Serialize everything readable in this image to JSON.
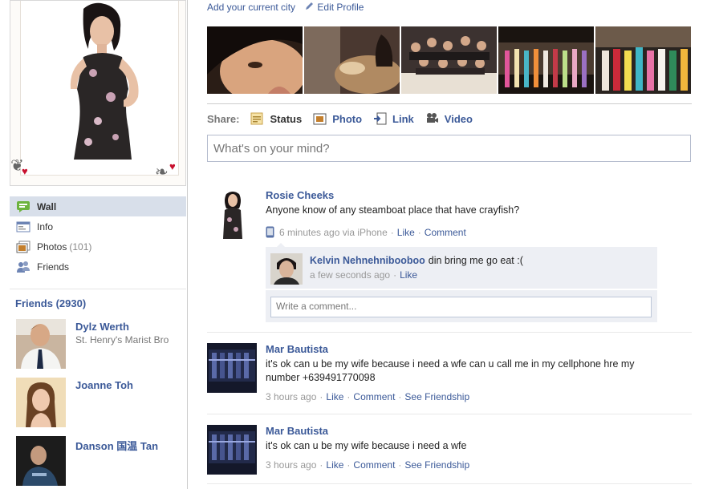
{
  "profile": {
    "top_links": {
      "add_city": "Add your current city",
      "edit_profile": "Edit Profile"
    }
  },
  "nav": {
    "items": [
      {
        "label": "Wall",
        "count": "",
        "icon": "wall-icon",
        "selected": true
      },
      {
        "label": "Info",
        "count": "",
        "icon": "info-icon"
      },
      {
        "label": "Photos",
        "count": "(101)",
        "icon": "photos-icon"
      },
      {
        "label": "Friends",
        "count": "",
        "icon": "friends-icon"
      }
    ]
  },
  "friends": {
    "title": "Friends (2930)",
    "items": [
      {
        "name": "Dylz Werth",
        "network": "St. Henry's Marist Bro"
      },
      {
        "name": "Joanne Toh",
        "network": ""
      },
      {
        "name": "Danson 国温 Tan",
        "network": ""
      }
    ]
  },
  "share": {
    "label": "Share:",
    "options": [
      {
        "label": "Status",
        "icon": "status-icon",
        "active": true
      },
      {
        "label": "Photo",
        "icon": "photo-icon"
      },
      {
        "label": "Link",
        "icon": "link-icon"
      },
      {
        "label": "Video",
        "icon": "video-icon"
      }
    ],
    "composer_placeholder": "What's on your mind?"
  },
  "stories": [
    {
      "actor": "Rosie Cheeks",
      "message": "Anyone know of any steamboat place that have crayfish?",
      "time": "6 minutes ago via iPhone",
      "actions": [
        "Like",
        "Comment"
      ],
      "comments": [
        {
          "author": "Kelvin Nehnehnibooboo",
          "text": "din bring me go eat :(",
          "time": "a few seconds ago",
          "action": "Like"
        }
      ],
      "comment_placeholder": "Write a comment..."
    },
    {
      "actor": "Mar Bautista",
      "message": "it's ok can u be my wife because i need a wfe can u call me in my cellphone hre my number +639491770098",
      "time": "3 hours ago",
      "actions": [
        "Like",
        "Comment",
        "See Friendship"
      ]
    },
    {
      "actor": "Mar Bautista",
      "message": "it's ok can u be my wife because i need a wfe",
      "time": "3 hours ago",
      "actions": [
        "Like",
        "Comment",
        "See Friendship"
      ]
    }
  ],
  "colors": {
    "link": "#3b5998",
    "selected_nav": "#d8dfea",
    "comment_bg": "#edeff4"
  }
}
